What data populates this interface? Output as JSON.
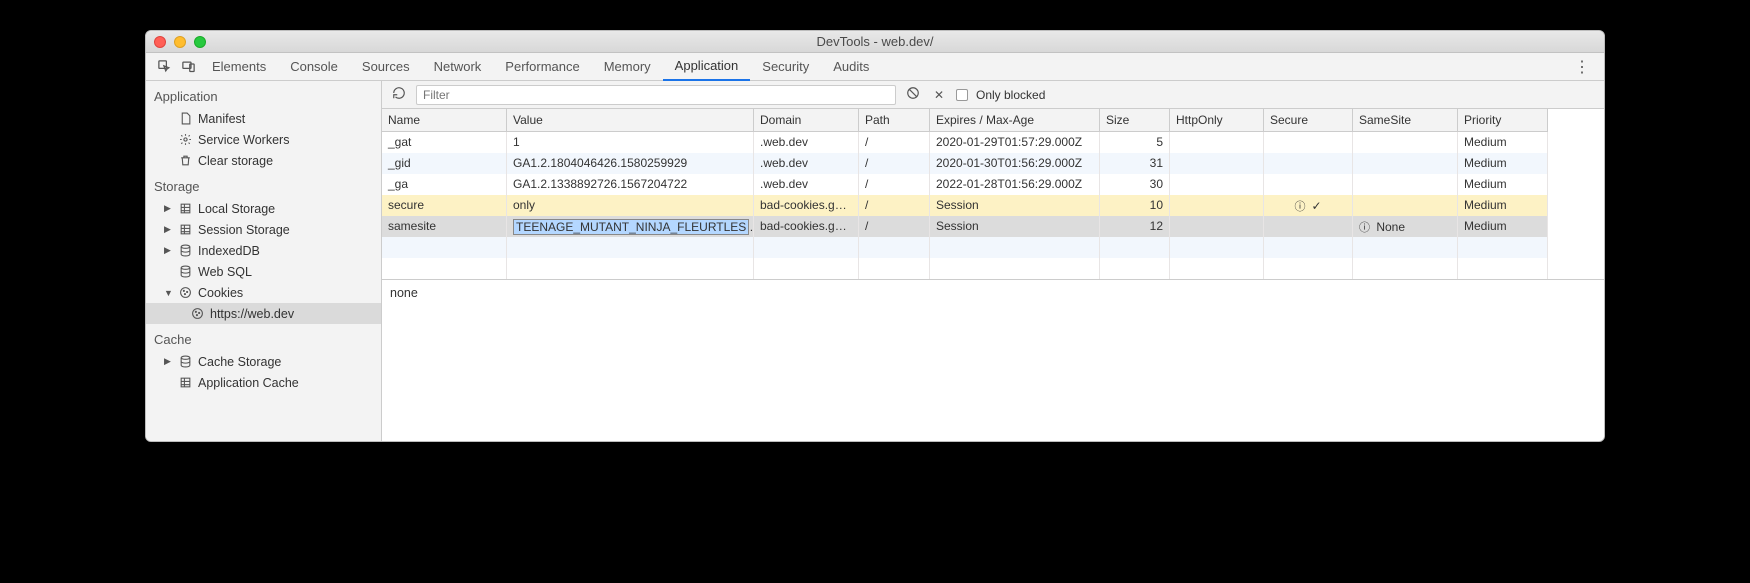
{
  "window": {
    "title": "DevTools - web.dev/"
  },
  "tabs": {
    "items": [
      "Elements",
      "Console",
      "Sources",
      "Network",
      "Performance",
      "Memory",
      "Application",
      "Security",
      "Audits"
    ],
    "active": "Application"
  },
  "toolbar": {
    "filter_placeholder": "Filter",
    "only_blocked_label": "Only blocked"
  },
  "sidebar": {
    "sections": {
      "application": {
        "title": "Application",
        "items": [
          {
            "label": "Manifest",
            "icon": "doc"
          },
          {
            "label": "Service Workers",
            "icon": "gear"
          },
          {
            "label": "Clear storage",
            "icon": "trash"
          }
        ]
      },
      "storage": {
        "title": "Storage",
        "items": [
          {
            "label": "Local Storage",
            "icon": "grid",
            "expandable": true
          },
          {
            "label": "Session Storage",
            "icon": "grid",
            "expandable": true
          },
          {
            "label": "IndexedDB",
            "icon": "db",
            "expandable": true
          },
          {
            "label": "Web SQL",
            "icon": "db"
          },
          {
            "label": "Cookies",
            "icon": "cookie",
            "expandable": true,
            "expanded": true,
            "children": [
              {
                "label": "https://web.dev",
                "icon": "cookie",
                "selected": true
              }
            ]
          }
        ]
      },
      "cache": {
        "title": "Cache",
        "items": [
          {
            "label": "Cache Storage",
            "icon": "db",
            "expandable": true
          },
          {
            "label": "Application Cache",
            "icon": "grid"
          }
        ]
      }
    }
  },
  "cookies": {
    "columns": [
      "Name",
      "Value",
      "Domain",
      "Path",
      "Expires / Max-Age",
      "Size",
      "HttpOnly",
      "Secure",
      "SameSite",
      "Priority"
    ],
    "rows": [
      {
        "name": "_gat",
        "value": "1",
        "domain": ".web.dev",
        "path": "/",
        "expires": "2020-01-29T01:57:29.000Z",
        "size": "5",
        "httponly": "",
        "secure": "",
        "samesite": "",
        "priority": "Medium",
        "row_state": "even"
      },
      {
        "name": "_gid",
        "value": "GA1.2.1804046426.1580259929",
        "domain": ".web.dev",
        "path": "/",
        "expires": "2020-01-30T01:56:29.000Z",
        "size": "31",
        "httponly": "",
        "secure": "",
        "samesite": "",
        "priority": "Medium",
        "row_state": "odd"
      },
      {
        "name": "_ga",
        "value": "GA1.2.1338892726.1567204722",
        "domain": ".web.dev",
        "path": "/",
        "expires": "2022-01-28T01:56:29.000Z",
        "size": "30",
        "httponly": "",
        "secure": "",
        "samesite": "",
        "priority": "Medium",
        "row_state": "even"
      },
      {
        "name": "secure",
        "value": "only",
        "domain": "bad-cookies.g…",
        "path": "/",
        "expires": "Session",
        "size": "10",
        "httponly": "",
        "secure": "info-check",
        "samesite": "",
        "priority": "Medium",
        "row_state": "highlight"
      },
      {
        "name": "samesite",
        "value": "TEENAGE_MUTANT_NINJA_FLEURTLES",
        "domain": "bad-cookies.g…",
        "path": "/",
        "expires": "Session",
        "size": "12",
        "httponly": "",
        "secure": "",
        "samesite": "info-none",
        "samesite_text": "None",
        "priority": "Medium",
        "row_state": "selected",
        "editing": true
      }
    ],
    "empty_rows": 2
  },
  "preview": {
    "text": "none"
  }
}
